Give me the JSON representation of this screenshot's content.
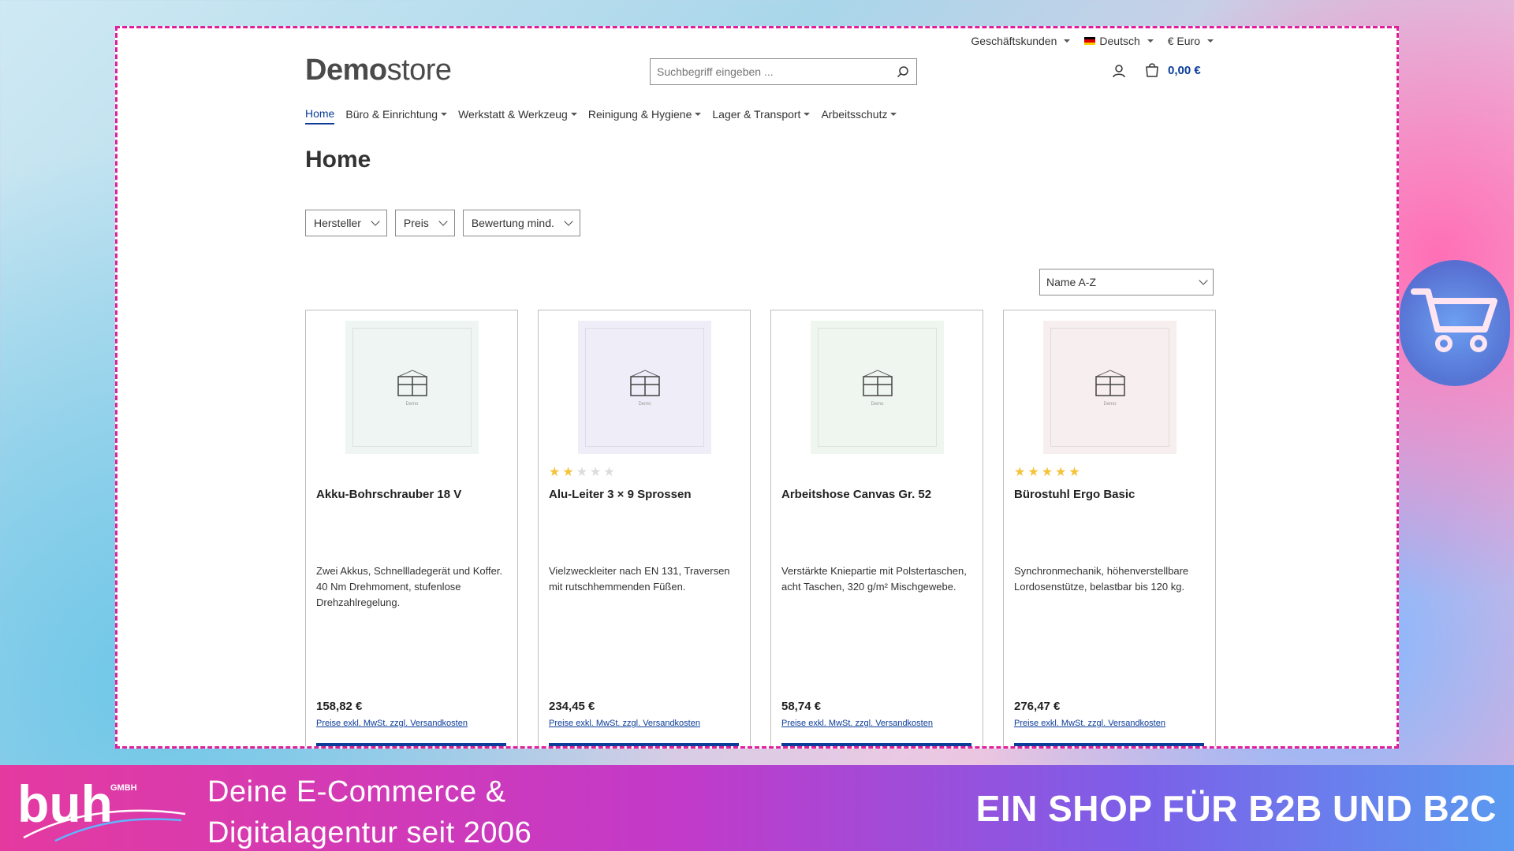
{
  "topbar": {
    "customer_group": "Geschäftskunden",
    "language": "Deutsch",
    "currency": "€ Euro"
  },
  "logo": {
    "bold": "Demo",
    "light": "store"
  },
  "search": {
    "placeholder": "Suchbegriff eingeben ..."
  },
  "cart": {
    "total": "0,00 €"
  },
  "nav": [
    {
      "label": "Home",
      "active": true
    },
    {
      "label": "Büro & Einrichtung"
    },
    {
      "label": "Werkstatt & Werkzeug"
    },
    {
      "label": "Reinigung & Hygiene"
    },
    {
      "label": "Lager & Transport"
    },
    {
      "label": "Arbeitsschutz"
    }
  ],
  "page": {
    "title": "Home"
  },
  "filters": [
    "Hersteller",
    "Preis",
    "Bewertung mind."
  ],
  "sort": {
    "selected": "Name A-Z"
  },
  "products": [
    {
      "name": "Akku-Bohrschrauber 18 V",
      "description": "Zwei Akkus, Schnellladegerät und Koffer. 40 Nm Drehmoment, stufenlose Drehzahlregelung.",
      "price": "158,82 €",
      "tax_note": "Preise exkl. MwSt. zzgl. Versandkosten",
      "rating": 0,
      "image_bg": "#eef5f2",
      "image_label": "Demo"
    },
    {
      "name": "Alu-Leiter 3 × 9 Sprossen",
      "description": "Vielzweckleiter nach EN 131, Traversen mit rutschhemmenden Füßen.",
      "price": "234,45 €",
      "tax_note": "Preise exkl. MwSt. zzgl. Versandkosten",
      "rating": 2,
      "image_bg": "#efedf7",
      "image_label": "Demo"
    },
    {
      "name": "Arbeitshose Canvas Gr. 52",
      "description": "Verstärkte Kniepartie mit Polstertaschen, acht Taschen, 320 g/m² Mischgewebe.",
      "price": "58,74 €",
      "tax_note": "Preise exkl. MwSt. zzgl. Versandkosten",
      "rating": 0,
      "image_bg": "#eff5ef",
      "image_label": "Demo"
    },
    {
      "name": "Bürostuhl Ergo Basic",
      "description": "Synchronmechanik, höhenverstellbare Lordosenstütze, belastbar bis 120 kg.",
      "price": "276,47 €",
      "tax_note": "Preise exkl. MwSt. zzgl. Versandkosten",
      "rating": 5,
      "image_bg": "#f6eeef",
      "image_label": "Demo"
    }
  ],
  "footer": {
    "brand": "buh",
    "brand_suffix": "GMBH",
    "tagline_line1": "Deine E-Commerce &",
    "tagline_line2": "Digitalagentur seit 2006",
    "claim": "EIN SHOP FÜR B2B UND B2C"
  },
  "colors": {
    "primary": "#0b3c99",
    "frame_border": "#e0209a",
    "star": "#f5c33b"
  },
  "icons": {
    "search": "search-icon",
    "account": "user-icon",
    "cart": "shopping-bag-icon"
  }
}
